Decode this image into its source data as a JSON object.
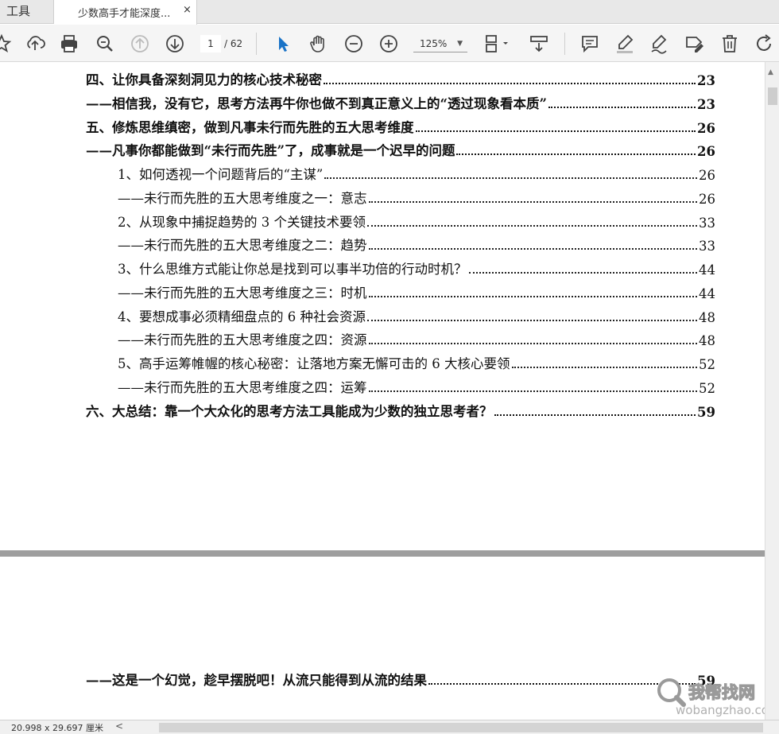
{
  "tabs": {
    "tools_label": "工具",
    "document_title": "少数高手才能深度...",
    "close_glyph": "×"
  },
  "toolbar": {
    "page_current": "1",
    "page_total": "/ 62",
    "zoom": "125%"
  },
  "toc": [
    {
      "text": "四、让你具备深刻洞见力的核心技术秘密",
      "page": "23",
      "bold": true
    },
    {
      "text": "——相信我，没有它，思考方法再牛你也做不到真正意义上的“透过现象看本质”",
      "page": "23",
      "bold": true
    },
    {
      "text": "五、修炼思维缜密，做到凡事未行而先胜的五大思考维度",
      "page": "26",
      "bold": true
    },
    {
      "text": "——凡事你都能做到“未行而先胜”了，成事就是一个迟早的问题",
      "page": "26",
      "bold": true
    },
    {
      "text": "1、如何透视一个问题背后的“主谋”",
      "page": "26",
      "bold": false
    },
    {
      "text": "——未行而先胜的五大思考维度之一：意志",
      "page": "26",
      "bold": false
    },
    {
      "text": "2、从现象中捕捉趋势的 3 个关键技术要领",
      "page": "33",
      "bold": false
    },
    {
      "text": "——未行而先胜的五大思考维度之二：趋势",
      "page": "33",
      "bold": false
    },
    {
      "text": "3、什么思维方式能让你总是找到可以事半功倍的行动时机？",
      "page": "44",
      "bold": false
    },
    {
      "text": "——未行而先胜的五大思考维度之三：时机",
      "page": "44",
      "bold": false
    },
    {
      "text": "4、要想成事必须精细盘点的 6 种社会资源",
      "page": "48",
      "bold": false
    },
    {
      "text": "——未行而先胜的五大思考维度之四：资源",
      "page": "48",
      "bold": false
    },
    {
      "text": "5、高手运筹帷幄的核心秘密：让落地方案无懈可击的 6 大核心要领",
      "page": "52",
      "bold": false
    },
    {
      "text": "——未行而先胜的五大思考维度之四：运筹",
      "page": "52",
      "bold": false
    },
    {
      "text": "六、大总结：靠一个大众化的思考方法工具能成为少数的独立思考者？",
      "page": "59",
      "bold": true
    },
    {
      "text": "——这是一个幻觉，趁早摆脱吧！从流只能得到从流的结果",
      "page": "59",
      "bold": true
    }
  ],
  "status": {
    "page_size": "20.998 x 29.697 厘米",
    "scroll_left_glyph": "<"
  },
  "watermark": {
    "site_name": "我帮找网",
    "site_url": "wobangzhao.com"
  }
}
